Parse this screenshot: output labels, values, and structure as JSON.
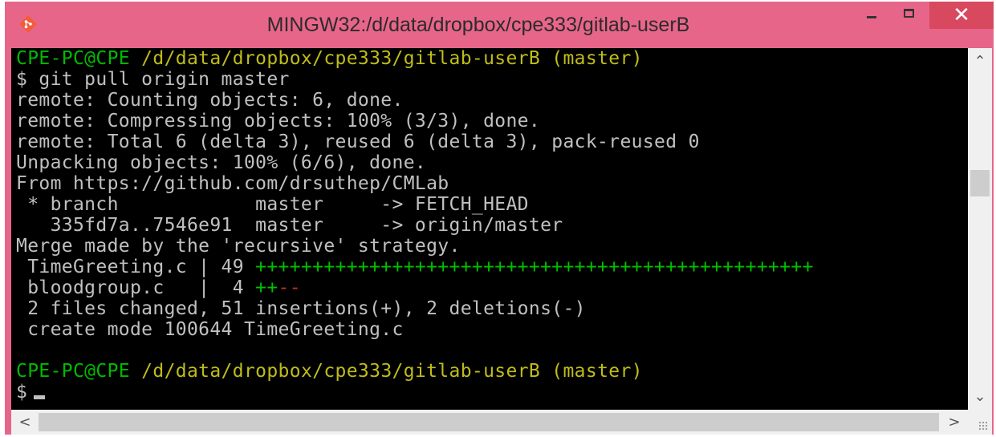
{
  "window": {
    "title": "MINGW32:/d/data/dropbox/cpe333/gitlab-userB",
    "app_icon": "git-diamond-icon",
    "controls": {
      "minimize_icon": "minimize-icon",
      "maximize_icon": "maximize-icon",
      "close_icon": "close-icon",
      "close_glyph": "✕"
    },
    "colors": {
      "titlebar": "#e8658a",
      "close_button": "#d8485f",
      "terminal_bg": "#000000",
      "prompt_user": "#00ba00",
      "prompt_path": "#bfbc1a",
      "plus": "#00c000",
      "minus": "#c03030"
    }
  },
  "terminal": {
    "prompt1": {
      "user": "CPE-PC@CPE",
      "path": " /d/data/dropbox/cpe333/gitlab-userB (master)"
    },
    "command": "$ git pull origin master",
    "output": [
      "remote: Counting objects: 6, done.",
      "remote: Compressing objects: 100% (3/3), done.",
      "remote: Total 6 (delta 3), reused 6 (delta 3), pack-reused 0",
      "Unpacking objects: 100% (6/6), done.",
      "From https://github.com/drsuthep/CMLab",
      " * branch            master     -> FETCH_HEAD",
      "   335fd7a..7546e91  master     -> origin/master",
      "Merge made by the 'recursive' strategy."
    ],
    "diffstat": [
      {
        "file": " TimeGreeting.c | 49 ",
        "plus": "+++++++++++++++++++++++++++++++++++++++++++++++++",
        "minus": ""
      },
      {
        "file": " bloodgroup.c   |  4 ",
        "plus": "++",
        "minus": "--"
      }
    ],
    "summary": [
      " 2 files changed, 51 insertions(+), 2 deletions(-)",
      " create mode 100644 TimeGreeting.c"
    ],
    "prompt2": {
      "user": "CPE-PC@CPE",
      "path": " /d/data/dropbox/cpe333/gitlab-userB (master)"
    },
    "prompt_symbol": "$"
  },
  "scrollbars": {
    "up": "⌃",
    "down": "⌄",
    "left": "<",
    "right": ">"
  }
}
